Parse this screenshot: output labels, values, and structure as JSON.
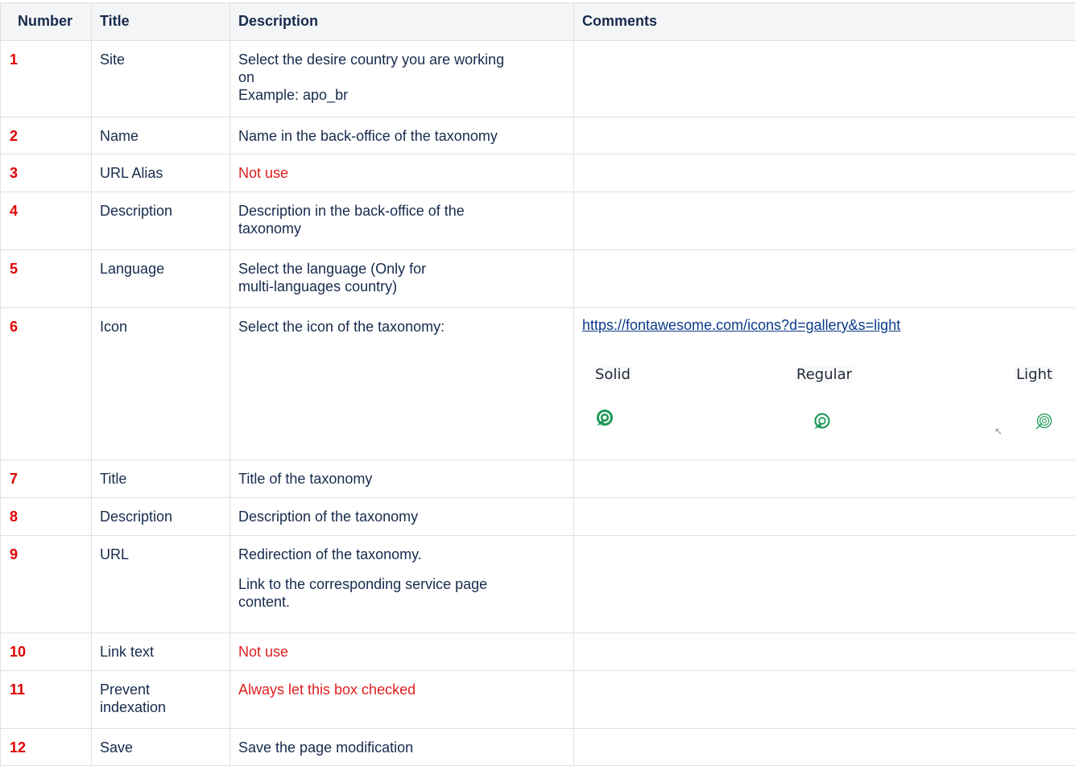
{
  "headers": {
    "number": "Number",
    "title": "Title",
    "description": "Description",
    "comments": "Comments"
  },
  "rows": [
    {
      "number": "1",
      "title": "Site",
      "description_lines": [
        "Select the desire country you are working",
        "on",
        "Example: apo_br"
      ]
    },
    {
      "number": "2",
      "title": "Name",
      "description": "Name in the back-office of the taxonomy"
    },
    {
      "number": "3",
      "title": "URL Alias",
      "description": "Not use"
    },
    {
      "number": "4",
      "title": "Description",
      "description_lines": [
        "Description in the back-office of the",
        "taxonomy"
      ]
    },
    {
      "number": "5",
      "title": "Language",
      "description_lines": [
        "Select the language (Only for",
        "multi-languages country)"
      ]
    },
    {
      "number": "6",
      "title": "Icon",
      "description": "Select the icon of the taxonomy:",
      "comment_link": "https://fontawesome.com/icons?d=gallery&s=light",
      "icon_styles": [
        "Solid",
        "Regular",
        "Light"
      ]
    },
    {
      "number": "7",
      "title": "Title",
      "description": "Title of the taxonomy"
    },
    {
      "number": "8",
      "title": "Description",
      "description": "Description of the taxonomy"
    },
    {
      "number": "9",
      "title": "URL",
      "description": "Redirection of the taxonomy.",
      "description_p2_lines": [
        "Link to the corresponding service page",
        "content."
      ]
    },
    {
      "number": "10",
      "title": "Link text",
      "description": "Not use"
    },
    {
      "number": "11",
      "title_lines": [
        "Prevent",
        "indexation"
      ],
      "description": "Always let this box checked"
    },
    {
      "number": "12",
      "title": "Save",
      "description": "Save the page modification"
    }
  ],
  "colors": {
    "number_red": "#de0000",
    "note_red": "#e01e1e",
    "icon_green": "#1f9a5a",
    "link_blue": "#0b3a8a"
  },
  "icons": {
    "solid": "bullseye-pointer-icon-solid",
    "regular": "bullseye-pointer-icon-regular",
    "light": "bullseye-pointer-icon-light"
  }
}
